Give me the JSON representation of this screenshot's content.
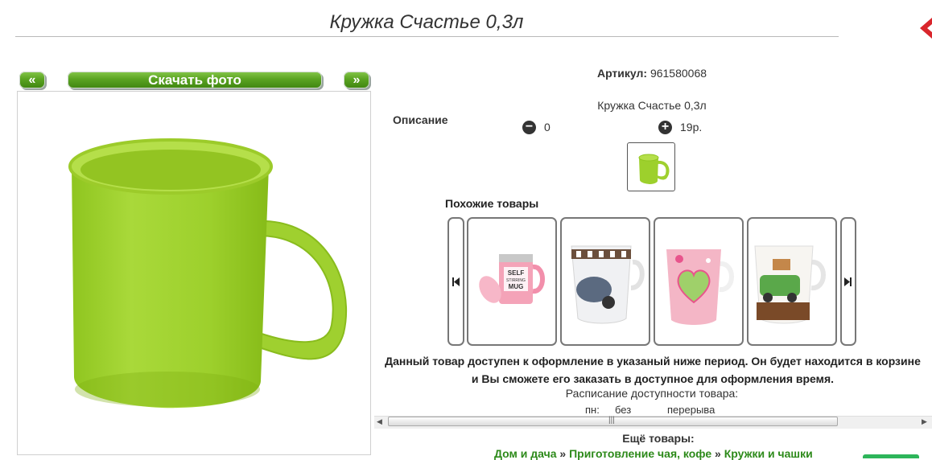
{
  "header": {
    "title": "Кружка Счастье 0,3л"
  },
  "photo_nav": {
    "prev_label": "«",
    "download_label": "Скачать фото",
    "next_label": "»"
  },
  "product": {
    "article_label": "Артикул:",
    "article_value": "961580068",
    "description_label": "Описание",
    "name": "Кружка Счастье 0,3л",
    "quantity": "0",
    "price": "19р."
  },
  "similar": {
    "title": "Похожие товары",
    "items": [
      "mug-self-stirring",
      "mug-bonbons",
      "mug-heart",
      "mug-car"
    ]
  },
  "availability": {
    "note_line1": "Данный товар доступен к оформление в указаный ниже период. Он будет находится в корзине",
    "note_line2": "и Вы сможете его заказать в доступное для оформления время.",
    "schedule_title": "Расписание доступности товара:",
    "day": "пн:",
    "from": "без",
    "break": "перерыва"
  },
  "more": {
    "label": "Ещё товары:",
    "crumbs": [
      "Дом и дача",
      "Приготовление чая, кофе",
      "Кружки и чашки"
    ],
    "separator": "»"
  },
  "colors": {
    "accent_green": "#5aa322",
    "link_green": "#2d8a1a",
    "close_red": "#d9262c"
  }
}
